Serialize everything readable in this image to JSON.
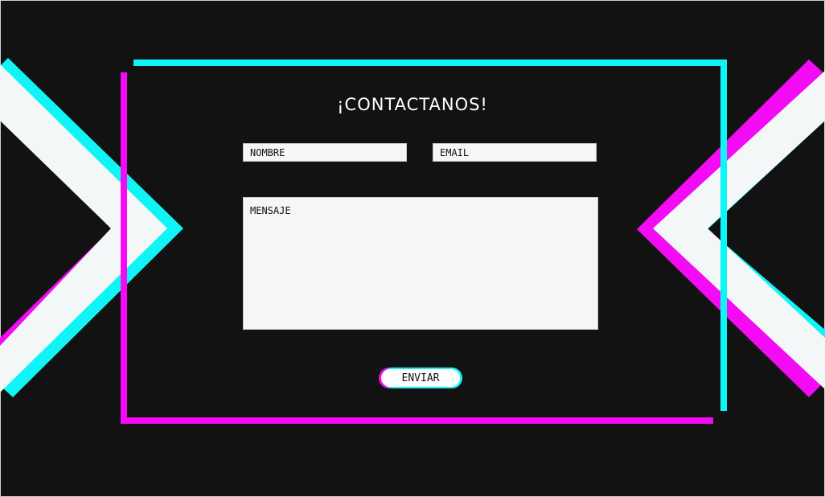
{
  "page": {
    "title": "¡CONTACTANOS!",
    "colors": {
      "background": "#121212",
      "accent_cyan": "#11f4f5",
      "accent_magenta": "#f30bf3",
      "field_background": "#f6f6f6"
    }
  },
  "form": {
    "name_placeholder": "NOMBRE",
    "name_value": "",
    "email_placeholder": "EMAIL",
    "email_value": "",
    "message_placeholder": "MENSAJE",
    "message_value": "",
    "submit_label": "ENVIAR"
  }
}
